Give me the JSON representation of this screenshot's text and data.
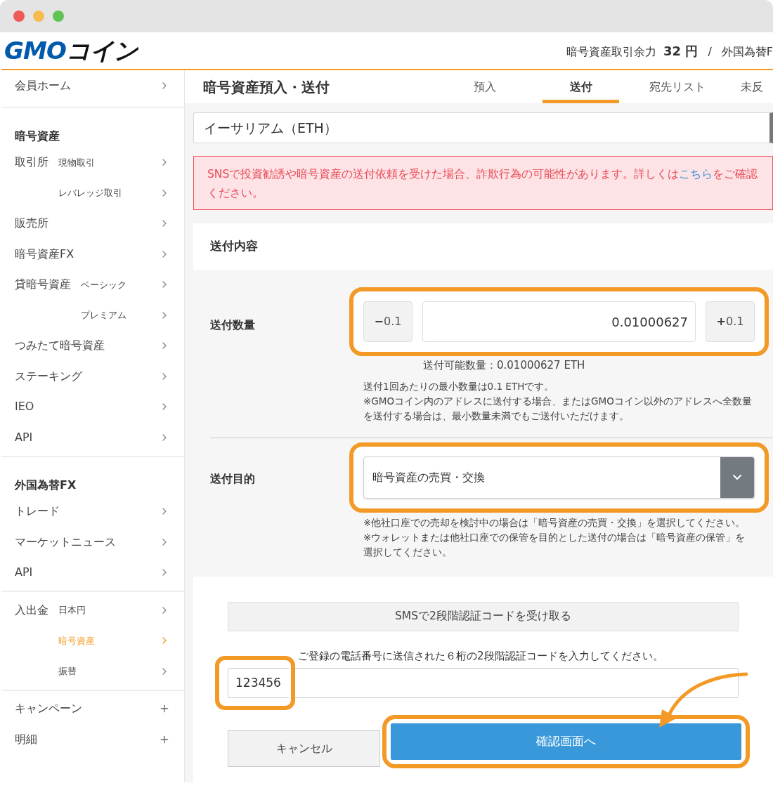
{
  "window": {
    "controls": [
      {
        "color": "#ee5b56"
      },
      {
        "color": "#f5bd4f"
      },
      {
        "color": "#5fc453"
      }
    ]
  },
  "header": {
    "logo": {
      "latin": "GMO",
      "kana": "コイン"
    },
    "balance_label": "暗号資産取引余力",
    "balance_value": "32 円",
    "separator": "/",
    "next_label": "外国為替F"
  },
  "sidebar": {
    "sections": [
      {
        "items": [
          {
            "label": "会員ホーム",
            "kind": "link",
            "selected": false
          }
        ]
      },
      {
        "heading": "暗号資産",
        "items": [
          {
            "label": "取引所",
            "kind": "group",
            "children": [
              {
                "label": "現物取引",
                "selected": false
              },
              {
                "label": "レバレッジ取引",
                "selected": false
              }
            ]
          },
          {
            "label": "販売所",
            "kind": "link",
            "selected": false
          },
          {
            "label": "暗号資産FX",
            "kind": "link",
            "selected": false
          },
          {
            "label": "貸暗号資産",
            "kind": "group",
            "children": [
              {
                "label": "ベーシック",
                "selected": false
              },
              {
                "label": "プレミアム",
                "selected": false
              }
            ]
          },
          {
            "label": "つみたて暗号資産",
            "kind": "link",
            "selected": false
          },
          {
            "label": "ステーキング",
            "kind": "link",
            "selected": false
          },
          {
            "label": "IEO",
            "kind": "link",
            "selected": false
          },
          {
            "label": "API",
            "kind": "link",
            "selected": false
          }
        ]
      },
      {
        "heading": "外国為替FX",
        "items": [
          {
            "label": "トレード",
            "kind": "link",
            "selected": false
          },
          {
            "label": "マーケットニュース",
            "kind": "link",
            "selected": false
          },
          {
            "label": "API",
            "kind": "link",
            "selected": false
          }
        ]
      },
      {
        "items": [
          {
            "label": "入出金",
            "kind": "group",
            "children": [
              {
                "label": "日本円",
                "selected": false
              },
              {
                "label": "暗号資産",
                "selected": true
              },
              {
                "label": "振替",
                "selected": false
              }
            ]
          }
        ]
      },
      {
        "items": [
          {
            "label": "キャンペーン",
            "kind": "expand",
            "selected": false
          },
          {
            "label": "明細",
            "kind": "expand",
            "selected": false
          }
        ]
      }
    ]
  },
  "page": {
    "title": "暗号資産預入・送付",
    "tabs": [
      {
        "label": "預入",
        "selected": false
      },
      {
        "label": "送付",
        "selected": true
      },
      {
        "label": "宛先リスト",
        "selected": false
      },
      {
        "label": "未反",
        "selected": false
      }
    ]
  },
  "coin_select": {
    "value": "イーサリアム（ETH）"
  },
  "alert": {
    "text": "SNSで投資勧誘や暗号資産の送付依頼を受けた場合、詐欺行為の可能性があります。詳しくは",
    "link": "こちら",
    "text_after": "をご確認ください。"
  },
  "form": {
    "title": "送付内容",
    "amount": {
      "label": "送付数量",
      "highlighted": true,
      "minus": {
        "sign": "−",
        "step": "0.1"
      },
      "value": "0.01000627",
      "plus": {
        "sign": "+",
        "step": "0.1"
      },
      "available": "送付可能数量：0.01000627 ETH",
      "notes": [
        "送付1回あたりの最小数量は0.1 ETHです。",
        "※GMOコイン内のアドレスに送付する場合、またはGMOコイン以外のアドレスへ全数量を送付する場合は、最小数量未満でもご送付いただけます。"
      ]
    },
    "purpose": {
      "label": "送付目的",
      "highlighted": true,
      "value": "暗号資産の売買・交換",
      "notes": [
        "※他社口座での売却を検討中の場合は「暗号資産の売買・交換」を選択してください。",
        "※ウォレットまたは他社口座での保管を目的とした送付の場合は「暗号資産の保管」を選択してください。"
      ]
    },
    "auth": {
      "sms_button": "SMSで2段階認証コードを受け取る",
      "instruction": "ご登録の電話番号に送信された６桁の2段階認証コードを入力してください。",
      "code": "123456",
      "highlighted": true
    },
    "buttons": {
      "cancel": "キャンセル",
      "confirm": "確認画面へ",
      "confirm_highlighted": true
    }
  }
}
